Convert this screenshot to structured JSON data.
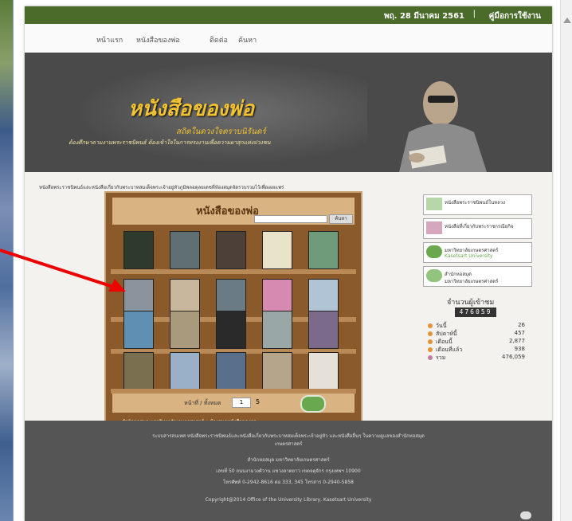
{
  "topbar": {
    "date": "พฤ. 28 มีนาคม 2561",
    "separator": "|",
    "manual": "คู่มือการใช้งาน"
  },
  "nav": {
    "items": [
      "หน้าแรก",
      "หนังสือของพ่อ",
      "ติดต่อ",
      "ค้นหา"
    ]
  },
  "banner": {
    "title": "หนังสือของพ่อ",
    "subtitle": "สถิตในดวงใจตราบนิรันดร์",
    "tagline": "ต้องศึกษาตามงานพระราชนิพนธ์ ต้องเข้าใจในการทรงงานเพื่อความผาสุกแห่งปวงชน"
  },
  "marquee": "หนังสือพระราชนิพนธ์และหนังสือเกี่ยวกับพระบาทสมเด็จพระเจ้าอยู่หัวภูมิพลอดุลยเดชที่ห้องสมุดจัดรวบรวมไว้เพื่อเผยแพร่",
  "shelf": {
    "title": "หนังสือของพ่อ",
    "search_label": "ค้นหา",
    "pager_label": "หน้าที่ / ทั้งหมด",
    "pager_value": "1",
    "pager_total": "5",
    "footer": "สำนักหอสมุด มหาวิทยาลัยเกษตรศาสตร์ • ห้องสมุดหนังสือของพ่อ"
  },
  "books_colors": [
    [
      "#2e3b2c",
      "#5f6f74",
      "#4d4038",
      "#e9e3c9",
      "#6f9b7a"
    ],
    [
      "#8b939c",
      "#c8b79c",
      "#6a7b85",
      "#d68ab1",
      "#b0c4d6"
    ],
    [
      "#5f8fb3",
      "#a99a7e",
      "#2a2a2a",
      "#9aa7a7",
      "#7b6a8a"
    ],
    [
      "#7a7050",
      "#9ab0c8",
      "#5a6f8c",
      "#b5a58a",
      "#e5e0d8"
    ]
  ],
  "sidebar": {
    "links": [
      "หนังสือพระราชนิพนธ์ในหลวง",
      "หนังสือที่เกี่ยวกับพระราชกรณียกิจ",
      "มหาวิทยาลัยเกษตรศาสตร์",
      "สำนักหอสมุด"
    ],
    "links_sub": [
      "",
      "",
      "Kasetsart University",
      "มหาวิทยาลัยเกษตรศาสตร์"
    ],
    "visit_title": "จำนวนผู้เข้าชม",
    "counter": "476059",
    "stats": [
      {
        "label": "วันนี้",
        "value": "26",
        "color": "#e69138"
      },
      {
        "label": "สัปดาห์นี้",
        "value": "457",
        "color": "#e69138"
      },
      {
        "label": "เดือนนี้",
        "value": "2,877",
        "color": "#e69138"
      },
      {
        "label": "เดือนที่แล้ว",
        "value": "938",
        "color": "#e69138"
      },
      {
        "label": "รวม",
        "value": "476,059",
        "color": "#c27ba0"
      }
    ]
  },
  "footer": {
    "line1": "ระบบสารสนเทศ หนังสือพระราชนิพนธ์และหนังสือเกี่ยวกับพระบาทสมเด็จพระเจ้าอยู่หัว และหนังสืออื่นๆ ในความดูแลของสำนักหอสมุด",
    "line2": "เกษตรศาสตร์",
    "line3": "สำนักหอสมุด มหาวิทยาลัยเกษตรศาสตร์",
    "line4": "เลขที่ 50 ถนนงามวงศ์วาน แขวงลาดยาว เขตจตุจักร กรุงเทพฯ 10900",
    "line5": "โทรศัพท์ 0-2942-8616 ต่อ 333, 345 โทรสาร 0-2940-5858",
    "copyright": "Copyright@2014 Office of the University Library, Kasetsart University"
  }
}
